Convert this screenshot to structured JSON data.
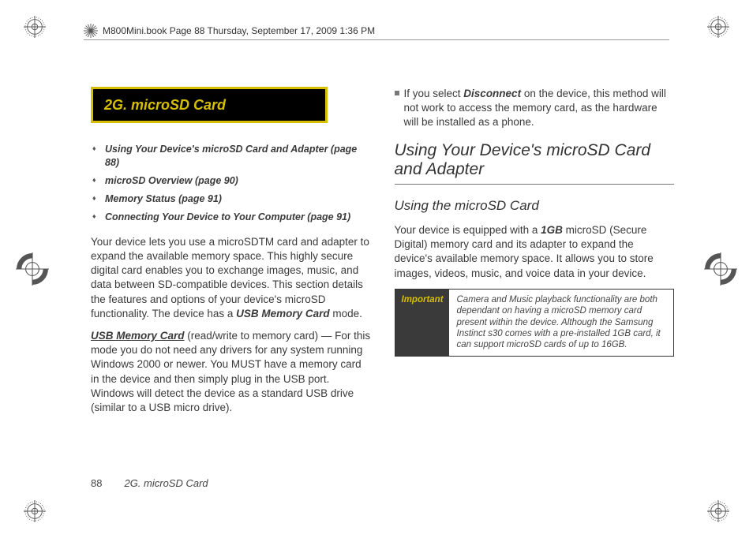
{
  "header": {
    "text": "M800Mini.book  Page 88  Thursday, September 17, 2009  1:36 PM"
  },
  "section": {
    "title": "2G. microSD Card"
  },
  "toc": {
    "items": [
      "Using Your Device's microSD Card and Adapter (page 88)",
      "microSD Overview (page 90)",
      "Memory Status (page 91)",
      "Connecting Your Device to Your Computer (page 91)"
    ]
  },
  "left": {
    "p1a": "Your device lets you use a microSDTM card and adapter to expand the available memory space. This highly secure digital card enables you to exchange images, music, and data between SD-compatible devices. This section details the features and options of your device's microSD functionality. The device has a ",
    "p1b": "USB Memory Card",
    "p1c": " mode.",
    "p2a": "USB Memory Card",
    "p2b": " (read/write to memory card) — For this mode you do not need any drivers for any system running Windows 2000 or newer. You MUST have a memory card in the device and then simply plug in the USB port. Windows will detect the device as a standard USB drive (similar to a USB micro drive)."
  },
  "right": {
    "bullet_a": "If you select ",
    "bullet_b": "Disconnect",
    "bullet_c": " on the device, this method will not work to access the memory card, as the hardware will be installed as a phone.",
    "h1": "Using Your Device's microSD Card and Adapter",
    "h2": "Using the microSD Card",
    "p1a": "Your device is equipped with a ",
    "p1b": "1GB",
    "p1c": " microSD (Secure Digital) memory card and its adapter to expand the device's available memory space. It allows you to store images, videos, music, and voice data in your device.",
    "important_label": "Important",
    "important_text": "Camera and Music playback functionality are both dependant on having a microSD memory card present within the device. Although the Samsung Instinct s30 comes with a pre-installed 1GB card, it can support microSD cards of up to 16GB."
  },
  "footer": {
    "page": "88",
    "title": "2G. microSD Card"
  }
}
